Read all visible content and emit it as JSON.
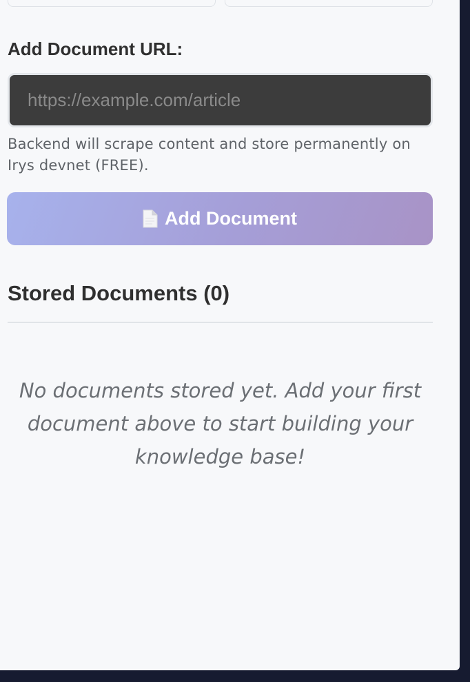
{
  "form": {
    "url_label": "Add Document URL:",
    "url_placeholder": "https://example.com/article",
    "url_value": "",
    "help_text": "Backend will scrape content and store permanently on Irys devnet (FREE).",
    "add_button_label": "Add Document",
    "add_button_icon": "document-icon"
  },
  "documents": {
    "title": "Stored Documents (0)",
    "count": 0,
    "empty_message": "No documents stored yet. Add your first document above to start building your knowledge base!"
  },
  "colors": {
    "button_gradient_start": "#a7b2ec",
    "button_gradient_end": "#a893c6",
    "input_background": "#3c3c3c",
    "page_background": "#f7f8fa",
    "outer_background": "#161b30"
  }
}
